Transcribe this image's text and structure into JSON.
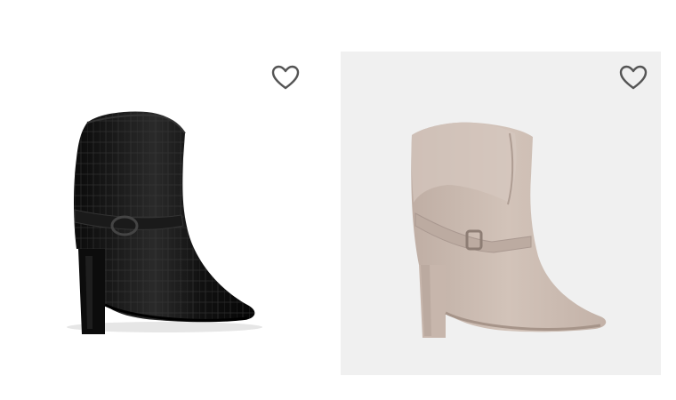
{
  "products": [
    {
      "image": "black-croc-embossed-cowboy-ankle-boot",
      "wishlist_icon": "heart-outline-icon",
      "background": "#ffffff",
      "boot_color": "#141414"
    },
    {
      "image": "taupe-suede-slouch-ankle-boot",
      "wishlist_icon": "heart-outline-icon",
      "background": "#f0f0f0",
      "boot_color": "#cbbbb1"
    }
  ],
  "colors": {
    "icon_stroke": "#555555"
  }
}
